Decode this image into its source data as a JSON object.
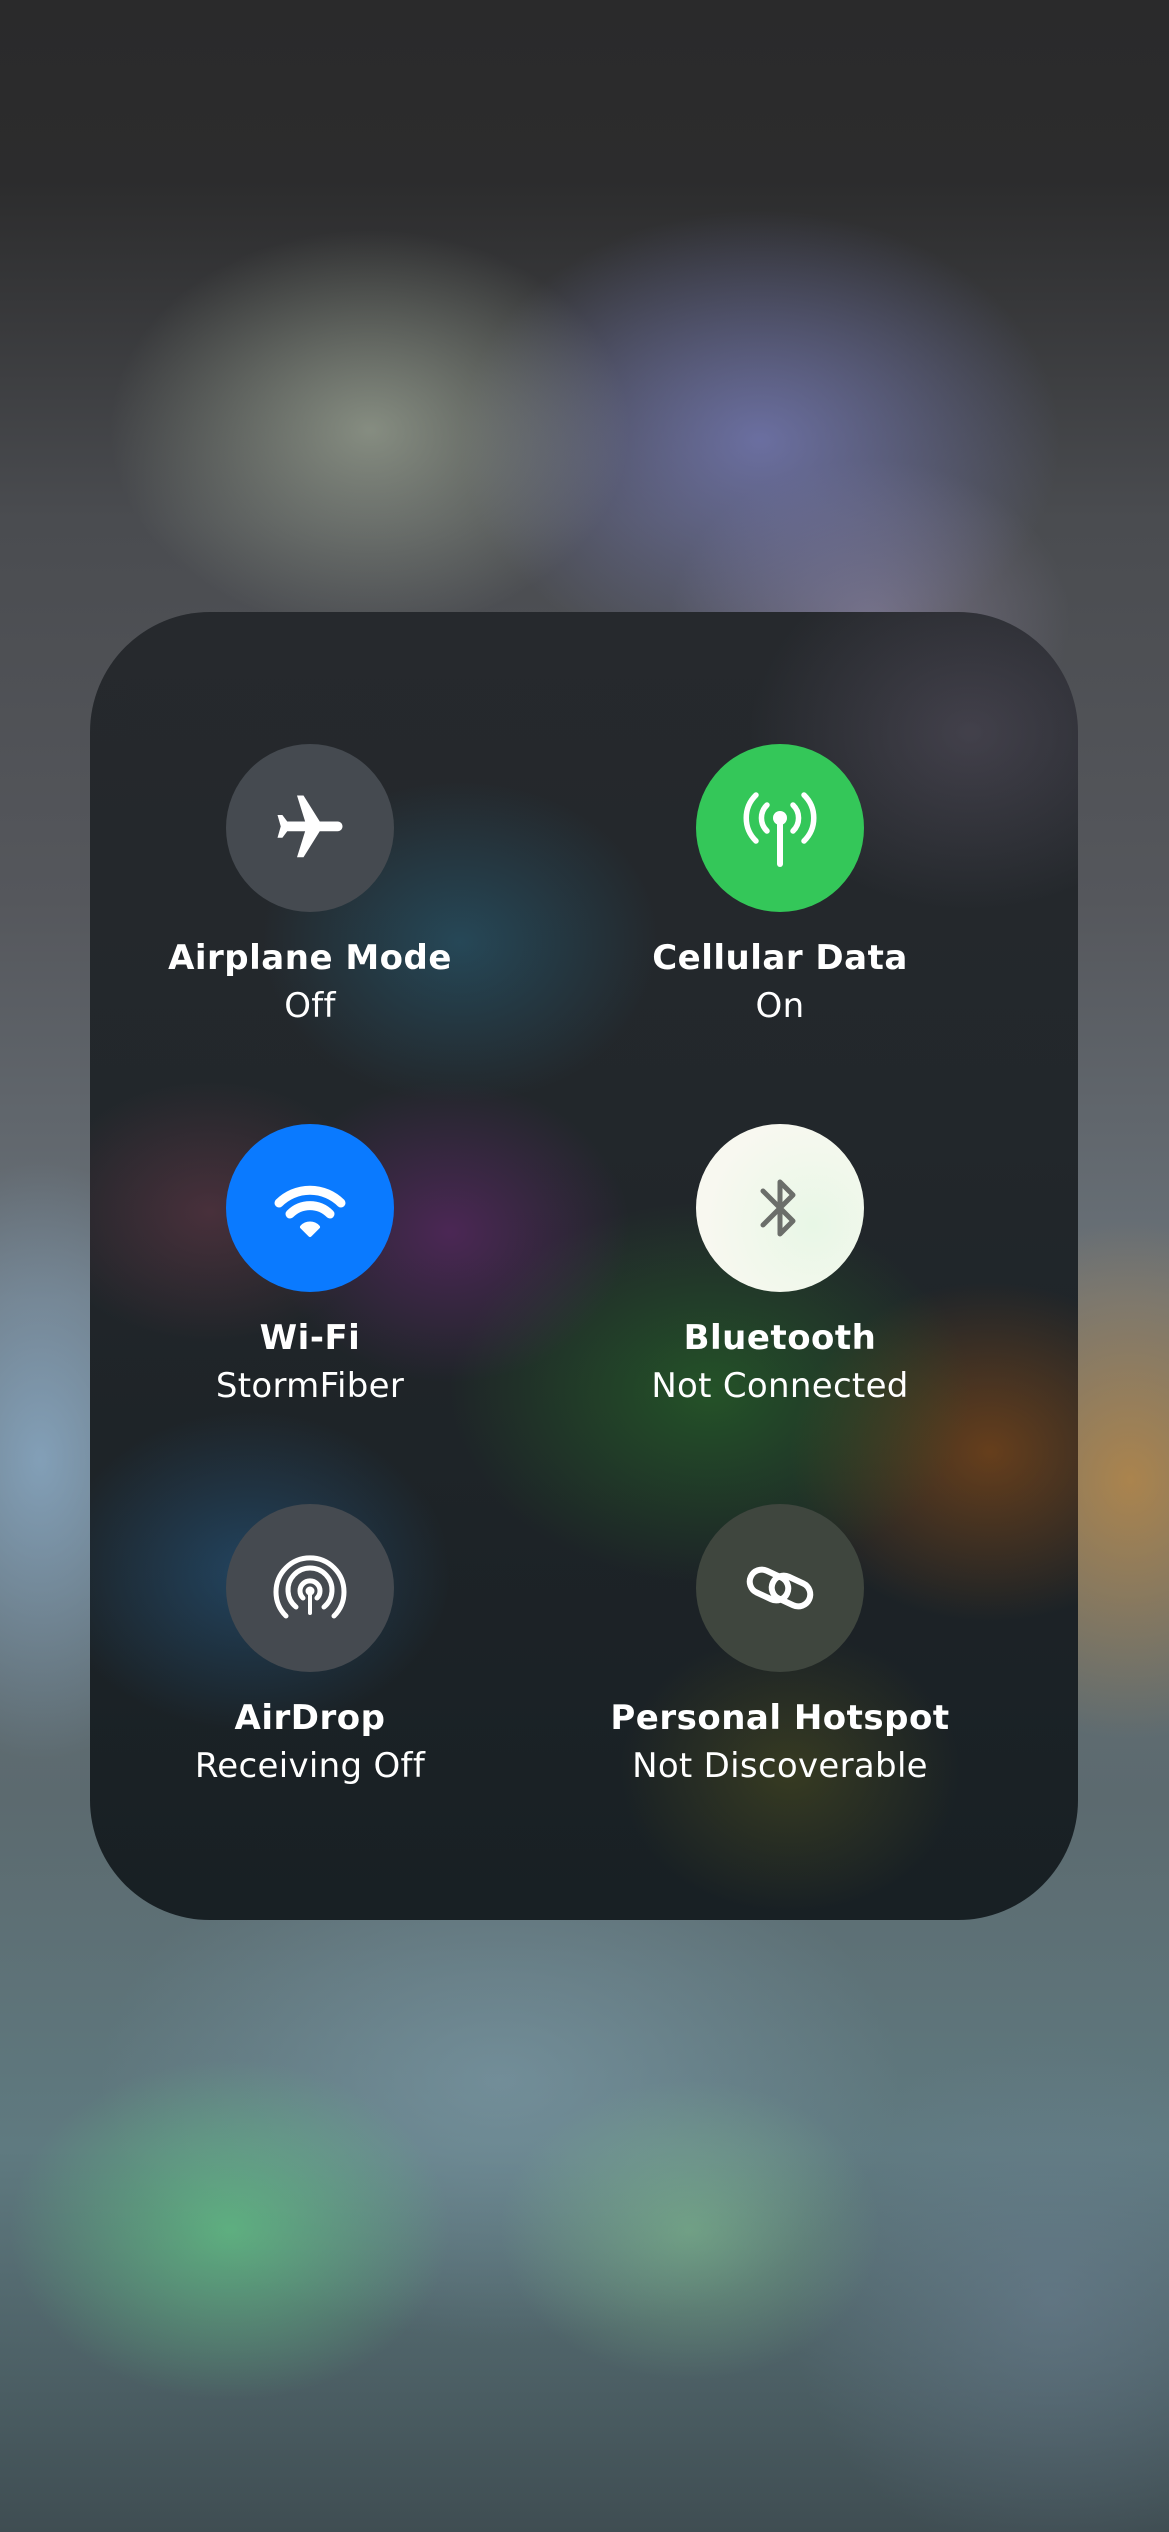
{
  "colors": {
    "toggle_off": "#454a50",
    "cellular_on": "#34c759",
    "wifi_on": "#0a7aff",
    "bluetooth_bg": "#f8f8f0",
    "hotspot_off": "#3f463e",
    "icon_on": "#ffffff",
    "bluetooth_icon": "#6b6e6a"
  },
  "tiles": [
    {
      "id": "airplane",
      "icon": "airplane-icon",
      "label": "Airplane Mode",
      "status": "Off",
      "enabled": false
    },
    {
      "id": "cellular",
      "icon": "antenna-icon",
      "label": "Cellular Data",
      "status": "On",
      "enabled": true
    },
    {
      "id": "wifi",
      "icon": "wifi-icon",
      "label": "Wi-Fi",
      "status": "StormFiber",
      "enabled": true
    },
    {
      "id": "bluetooth",
      "icon": "bluetooth-icon",
      "label": "Bluetooth",
      "status": "Not Connected",
      "enabled": true
    },
    {
      "id": "airdrop",
      "icon": "airdrop-icon",
      "label": "AirDrop",
      "status": "Receiving Off",
      "enabled": false
    },
    {
      "id": "hotspot",
      "icon": "link-icon",
      "label": "Personal Hotspot",
      "status": "Not Discoverable",
      "enabled": false
    }
  ]
}
